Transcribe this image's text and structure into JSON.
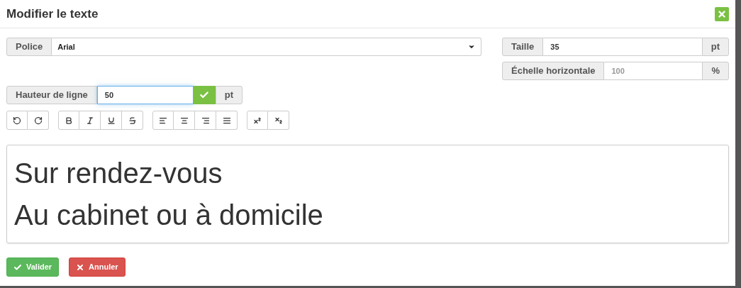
{
  "dialog": {
    "title": "Modifier le texte"
  },
  "font": {
    "label": "Police",
    "value": "Arial"
  },
  "size": {
    "label": "Taille",
    "value": "35",
    "unit": "pt"
  },
  "scale": {
    "label": "Échelle horizontale",
    "placeholder": "100",
    "unit": "%"
  },
  "line_height": {
    "label": "Hauteur de ligne",
    "value": "50",
    "unit": "pt",
    "focused": true
  },
  "toolbar": [
    [
      {
        "kind": "undo"
      },
      {
        "kind": "redo"
      }
    ],
    [
      {
        "kind": "bold"
      },
      {
        "kind": "italic"
      },
      {
        "kind": "underline"
      },
      {
        "kind": "strikethrough"
      }
    ],
    [
      {
        "kind": "align-left"
      },
      {
        "kind": "align-center"
      },
      {
        "kind": "align-right"
      },
      {
        "kind": "align-justify"
      }
    ],
    [
      {
        "kind": "superscript"
      },
      {
        "kind": "subscript"
      }
    ]
  ],
  "editor": {
    "lines": [
      "Sur rendez-vous",
      "Au cabinet ou à domicile"
    ]
  },
  "buttons": [
    {
      "label": "Valider",
      "kind": "confirm"
    },
    {
      "label": "Annuler",
      "kind": "cancel"
    }
  ]
}
